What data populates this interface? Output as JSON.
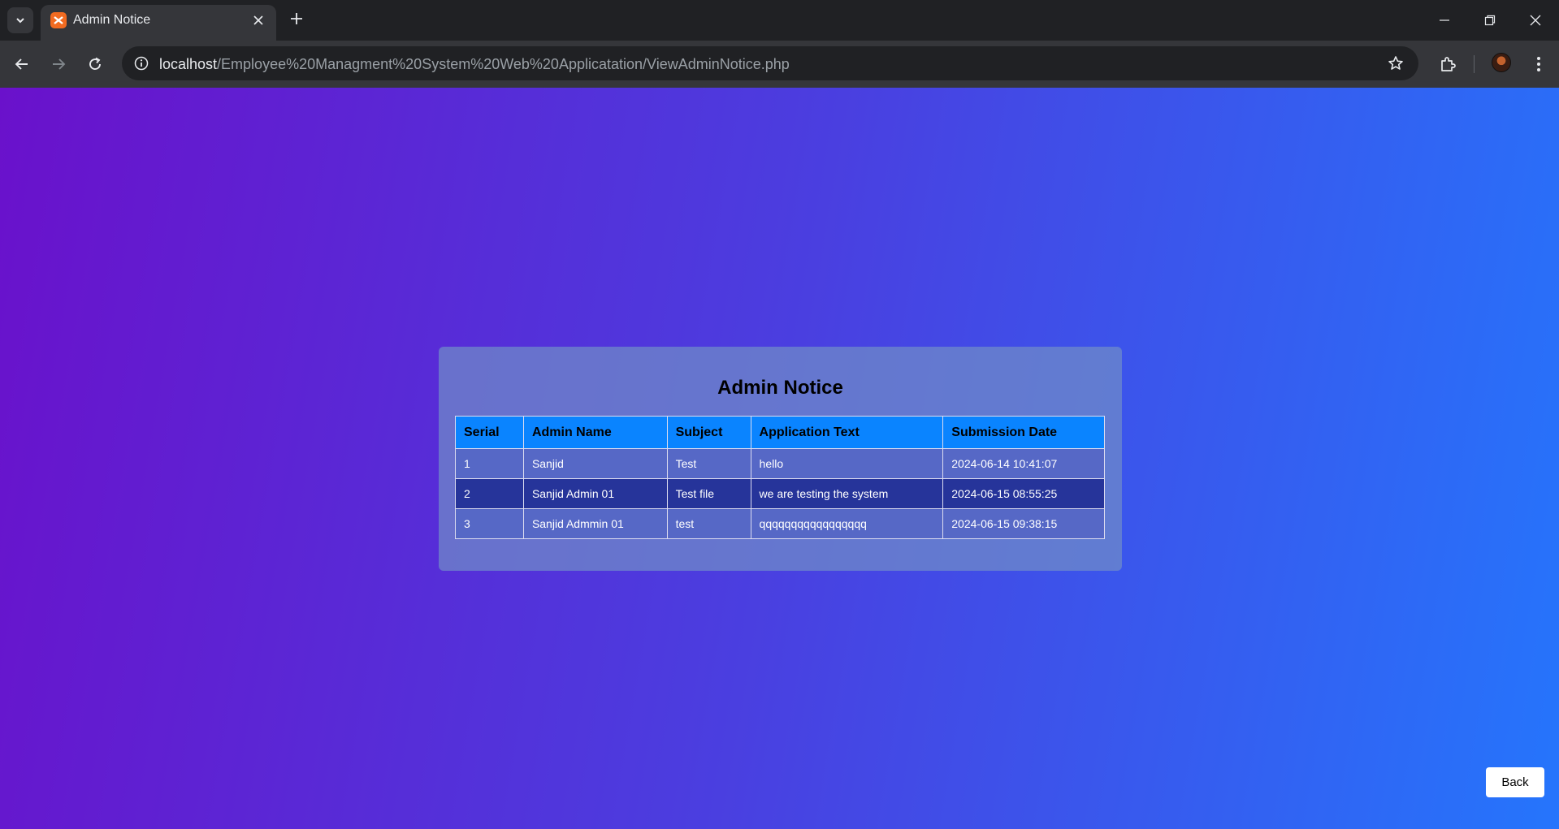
{
  "browser": {
    "tab": {
      "title": "Admin Notice"
    },
    "address": {
      "host": "localhost",
      "path": "/Employee%20Managment%20System%20Web%20Applicatation/ViewAdminNotice.php"
    }
  },
  "page": {
    "title": "Admin Notice",
    "table": {
      "headers": [
        "Serial",
        "Admin Name",
        "Subject",
        "Application Text",
        "Submission Date"
      ],
      "rows": [
        [
          "1",
          "Sanjid",
          "Test",
          "hello",
          "2024-06-14 10:41:07"
        ],
        [
          "2",
          "Sanjid Admin 01",
          "Test file",
          "we are testing the system",
          "2024-06-15 08:55:25"
        ],
        [
          "3",
          "Sanjid Admmin 01",
          "test",
          "qqqqqqqqqqqqqqqqq",
          "2024-06-15 09:38:15"
        ]
      ]
    },
    "back_label": "Back"
  },
  "colors": {
    "gradient_start": "#6a11cb",
    "gradient_end": "#2575fc",
    "header_bg": "#0a84ff",
    "row_odd": "#5668c6",
    "row_even": "#26349a"
  }
}
